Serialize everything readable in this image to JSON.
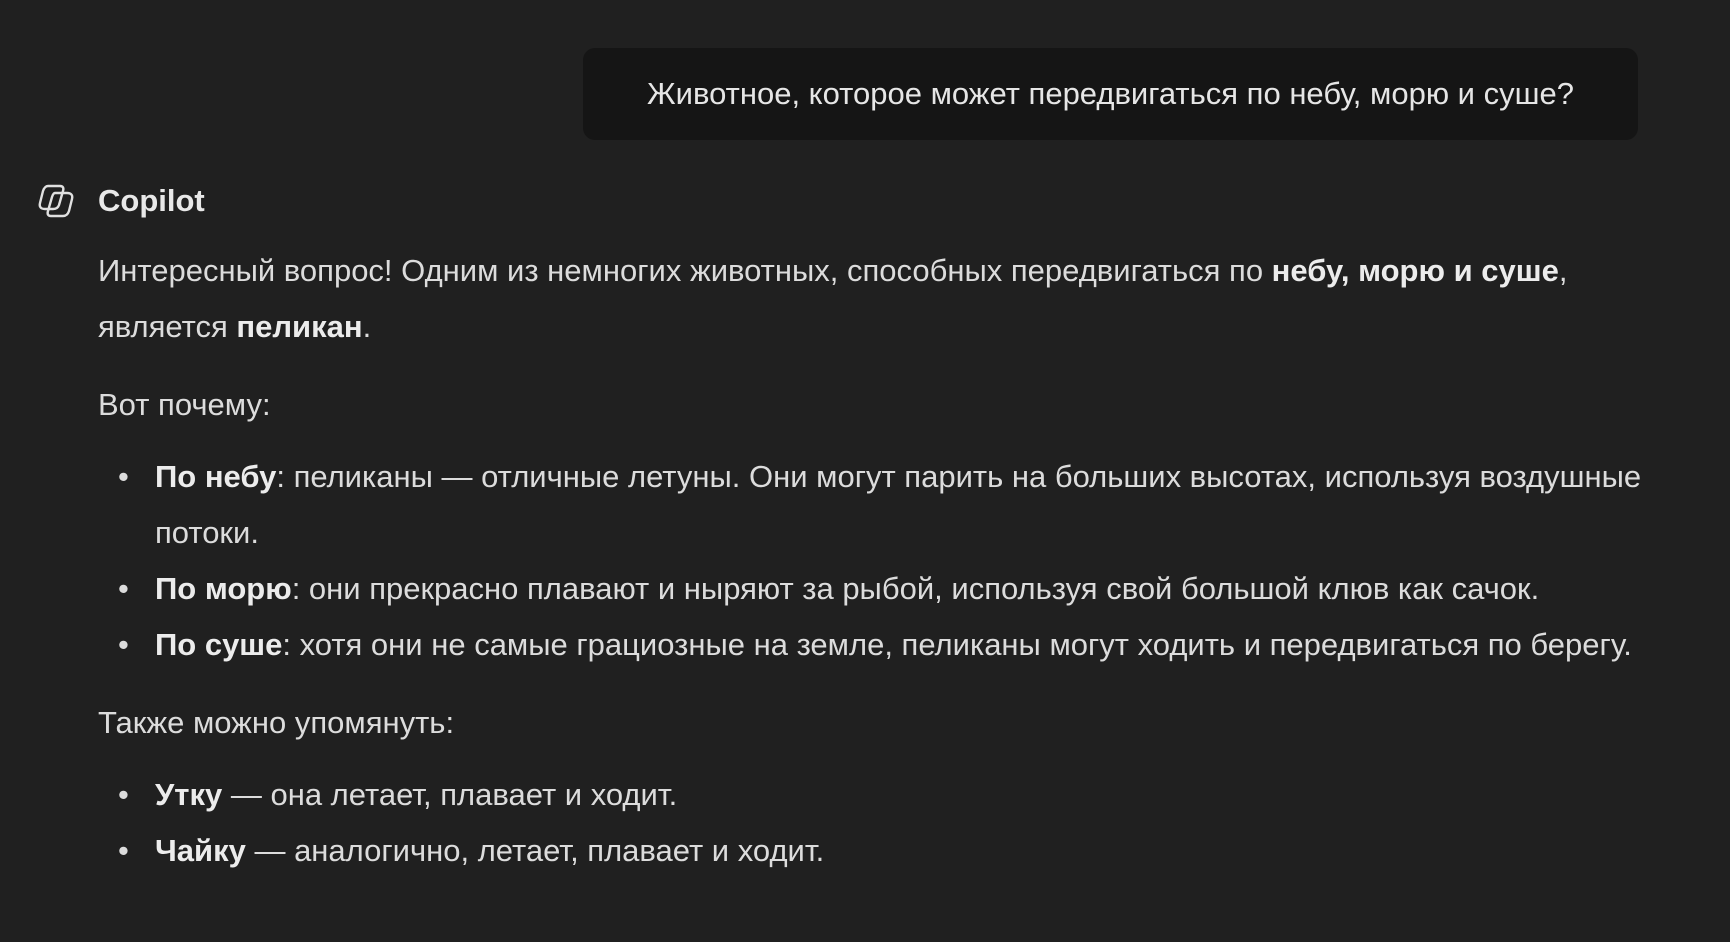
{
  "user_message": "Животное, которое может передвигаться по небу, морю и суше?",
  "assistant": {
    "name": "Copilot",
    "icon": "copilot-logo-icon"
  },
  "answer": {
    "intro": {
      "text1": "Интересный вопрос! Одним из немногих животных, способных передвигаться по ",
      "bold1": "небу, морю и суше",
      "text2": ", является ",
      "bold2": "пеликан",
      "text3": "."
    },
    "why_heading": "Вот почему:",
    "reasons": [
      {
        "bold": "По небу",
        "text": ": пеликаны — отличные летуны. Они могут парить на больших высотах, используя воздушные потоки."
      },
      {
        "bold": "По морю",
        "text": ": они прекрасно плавают и ныряют за рыбой, используя свой большой клюв как сачок."
      },
      {
        "bold": "По суше",
        "text": ": хотя они не самые грациозные на земле, пеликаны могут ходить и передвигаться по берегу."
      }
    ],
    "also_heading": "Также можно упомянуть:",
    "also": [
      {
        "bold": "Утку",
        "text": " — она летает, плавает и ходит."
      },
      {
        "bold": "Чайку",
        "text": " — аналогично, летает, плавает и ходит."
      }
    ]
  },
  "colors": {
    "background": "#202020",
    "user_bubble": "#151515",
    "text": "#dcdcdc"
  }
}
